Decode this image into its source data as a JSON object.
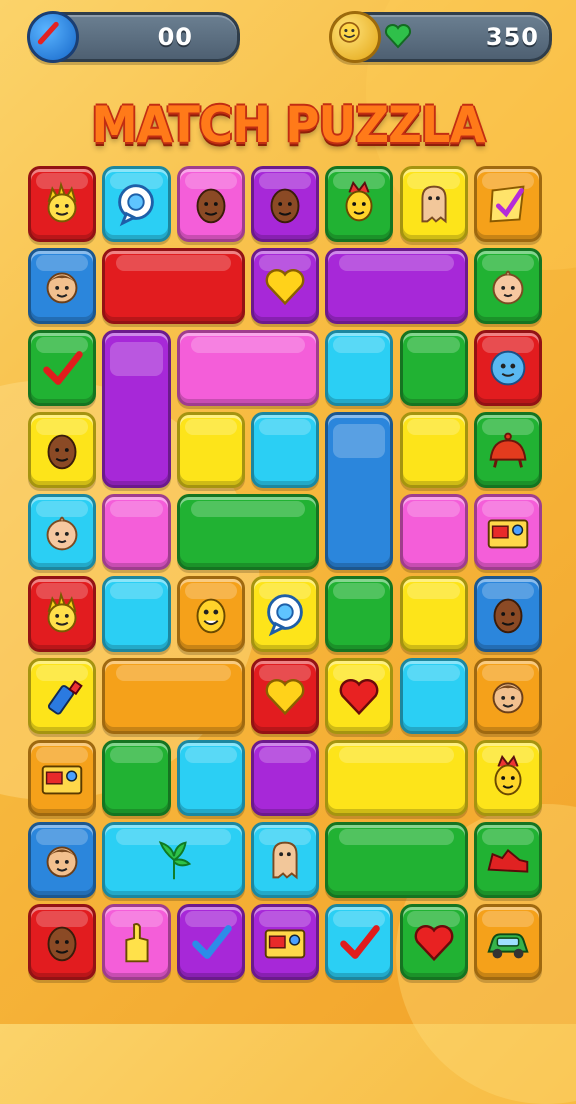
{
  "hud": {
    "left_value": "00",
    "right_value": "350",
    "left_icon": "pencil-icon",
    "right_icon": "smiley-coin-icon",
    "heart_icon": "green-heart-icon"
  },
  "title": "MATCH PUZZLA",
  "colors": {
    "red": "#e21c1f",
    "cyan": "#2bcff4",
    "pink": "#f45ed9",
    "purple": "#a728d8",
    "green": "#21b233",
    "yellow": "#fde41a",
    "orange": "#f5a11a",
    "blue": "#2b86dc"
  },
  "board": {
    "columns": 7,
    "rows": 10,
    "tiles": [
      {
        "r": 0,
        "c": 0,
        "w": 1,
        "h": 1,
        "color": "red",
        "icon": "spiky-face"
      },
      {
        "r": 0,
        "c": 1,
        "w": 1,
        "h": 1,
        "color": "cyan",
        "icon": "speech-bubble"
      },
      {
        "r": 0,
        "c": 2,
        "w": 1,
        "h": 1,
        "color": "pink",
        "icon": "brown-face"
      },
      {
        "r": 0,
        "c": 3,
        "w": 1,
        "h": 1,
        "color": "purple",
        "icon": "brown-face"
      },
      {
        "r": 0,
        "c": 4,
        "w": 1,
        "h": 1,
        "color": "green",
        "icon": "leaf-face"
      },
      {
        "r": 0,
        "c": 5,
        "w": 1,
        "h": 1,
        "color": "yellow",
        "icon": "ghost"
      },
      {
        "r": 0,
        "c": 6,
        "w": 1,
        "h": 1,
        "color": "orange",
        "icon": "check-card"
      },
      {
        "r": 1,
        "c": 0,
        "w": 1,
        "h": 1,
        "color": "blue",
        "icon": "boy-face"
      },
      {
        "r": 1,
        "c": 1,
        "w": 2,
        "h": 1,
        "color": "red",
        "icon": ""
      },
      {
        "r": 1,
        "c": 3,
        "w": 1,
        "h": 1,
        "color": "purple",
        "icon": "heart"
      },
      {
        "r": 1,
        "c": 4,
        "w": 2,
        "h": 1,
        "color": "purple",
        "icon": ""
      },
      {
        "r": 1,
        "c": 6,
        "w": 1,
        "h": 1,
        "color": "green",
        "icon": "baby-face"
      },
      {
        "r": 2,
        "c": 0,
        "w": 1,
        "h": 1,
        "color": "green",
        "icon": "checkmark"
      },
      {
        "r": 2,
        "c": 1,
        "w": 1,
        "h": 2,
        "color": "purple",
        "icon": ""
      },
      {
        "r": 2,
        "c": 2,
        "w": 2,
        "h": 1,
        "color": "pink",
        "icon": ""
      },
      {
        "r": 2,
        "c": 4,
        "w": 1,
        "h": 1,
        "color": "cyan",
        "icon": ""
      },
      {
        "r": 2,
        "c": 5,
        "w": 1,
        "h": 1,
        "color": "green",
        "icon": ""
      },
      {
        "r": 2,
        "c": 6,
        "w": 1,
        "h": 1,
        "color": "red",
        "icon": "blue-blob"
      },
      {
        "r": 3,
        "c": 0,
        "w": 1,
        "h": 1,
        "color": "yellow",
        "icon": "brown-face"
      },
      {
        "r": 3,
        "c": 2,
        "w": 1,
        "h": 1,
        "color": "yellow",
        "icon": ""
      },
      {
        "r": 3,
        "c": 3,
        "w": 1,
        "h": 1,
        "color": "cyan",
        "icon": ""
      },
      {
        "r": 3,
        "c": 4,
        "w": 1,
        "h": 2,
        "color": "blue",
        "icon": ""
      },
      {
        "r": 3,
        "c": 5,
        "w": 1,
        "h": 1,
        "color": "yellow",
        "icon": ""
      },
      {
        "r": 3,
        "c": 6,
        "w": 1,
        "h": 1,
        "color": "green",
        "icon": "red-creature"
      },
      {
        "r": 4,
        "c": 0,
        "w": 1,
        "h": 1,
        "color": "cyan",
        "icon": "baby-face"
      },
      {
        "r": 4,
        "c": 1,
        "w": 1,
        "h": 1,
        "color": "pink",
        "icon": ""
      },
      {
        "r": 4,
        "c": 2,
        "w": 2,
        "h": 1,
        "color": "green",
        "icon": ""
      },
      {
        "r": 4,
        "c": 5,
        "w": 1,
        "h": 1,
        "color": "pink",
        "icon": ""
      },
      {
        "r": 4,
        "c": 6,
        "w": 1,
        "h": 1,
        "color": "pink",
        "icon": "camera"
      },
      {
        "r": 5,
        "c": 0,
        "w": 1,
        "h": 1,
        "color": "red",
        "icon": "spiky-face"
      },
      {
        "r": 5,
        "c": 1,
        "w": 1,
        "h": 1,
        "color": "cyan",
        "icon": ""
      },
      {
        "r": 5,
        "c": 2,
        "w": 1,
        "h": 1,
        "color": "orange",
        "icon": "yellow-face"
      },
      {
        "r": 5,
        "c": 3,
        "w": 1,
        "h": 1,
        "color": "yellow",
        "icon": "speech-bubble"
      },
      {
        "r": 5,
        "c": 4,
        "w": 1,
        "h": 1,
        "color": "green",
        "icon": ""
      },
      {
        "r": 5,
        "c": 5,
        "w": 1,
        "h": 1,
        "color": "yellow",
        "icon": ""
      },
      {
        "r": 5,
        "c": 6,
        "w": 1,
        "h": 1,
        "color": "blue",
        "icon": "brown-face"
      },
      {
        "r": 6,
        "c": 0,
        "w": 1,
        "h": 1,
        "color": "yellow",
        "icon": "bottle"
      },
      {
        "r": 6,
        "c": 1,
        "w": 2,
        "h": 1,
        "color": "orange",
        "icon": ""
      },
      {
        "r": 6,
        "c": 3,
        "w": 1,
        "h": 1,
        "color": "red",
        "icon": "heart"
      },
      {
        "r": 6,
        "c": 4,
        "w": 1,
        "h": 1,
        "color": "yellow",
        "icon": "red-heart"
      },
      {
        "r": 6,
        "c": 5,
        "w": 1,
        "h": 1,
        "color": "cyan",
        "icon": ""
      },
      {
        "r": 6,
        "c": 6,
        "w": 1,
        "h": 1,
        "color": "orange",
        "icon": "boy-face"
      },
      {
        "r": 7,
        "c": 0,
        "w": 1,
        "h": 1,
        "color": "orange",
        "icon": "camera"
      },
      {
        "r": 7,
        "c": 1,
        "w": 1,
        "h": 1,
        "color": "green",
        "icon": ""
      },
      {
        "r": 7,
        "c": 2,
        "w": 1,
        "h": 1,
        "color": "cyan",
        "icon": ""
      },
      {
        "r": 7,
        "c": 3,
        "w": 1,
        "h": 1,
        "color": "purple",
        "icon": ""
      },
      {
        "r": 7,
        "c": 4,
        "w": 2,
        "h": 1,
        "color": "yellow",
        "icon": ""
      },
      {
        "r": 7,
        "c": 6,
        "w": 1,
        "h": 1,
        "color": "yellow",
        "icon": "leaf-face"
      },
      {
        "r": 8,
        "c": 0,
        "w": 1,
        "h": 1,
        "color": "blue",
        "icon": "boy-face"
      },
      {
        "r": 8,
        "c": 1,
        "w": 2,
        "h": 1,
        "color": "cyan",
        "icon": "leaf"
      },
      {
        "r": 8,
        "c": 3,
        "w": 1,
        "h": 1,
        "color": "cyan",
        "icon": "ghost"
      },
      {
        "r": 8,
        "c": 4,
        "w": 2,
        "h": 1,
        "color": "green",
        "icon": ""
      },
      {
        "r": 8,
        "c": 6,
        "w": 1,
        "h": 1,
        "color": "green",
        "icon": "red-shoe"
      },
      {
        "r": 9,
        "c": 0,
        "w": 1,
        "h": 1,
        "color": "red",
        "icon": "brown-face"
      },
      {
        "r": 9,
        "c": 1,
        "w": 1,
        "h": 1,
        "color": "pink",
        "icon": "hand"
      },
      {
        "r": 9,
        "c": 2,
        "w": 1,
        "h": 1,
        "color": "purple",
        "icon": "checkmark-blue"
      },
      {
        "r": 9,
        "c": 3,
        "w": 1,
        "h": 1,
        "color": "purple",
        "icon": "camera"
      },
      {
        "r": 9,
        "c": 4,
        "w": 1,
        "h": 1,
        "color": "cyan",
        "icon": "checkmark"
      },
      {
        "r": 9,
        "c": 5,
        "w": 1,
        "h": 1,
        "color": "green",
        "icon": "red-heart"
      },
      {
        "r": 9,
        "c": 6,
        "w": 1,
        "h": 1,
        "color": "orange",
        "icon": "car"
      }
    ]
  }
}
